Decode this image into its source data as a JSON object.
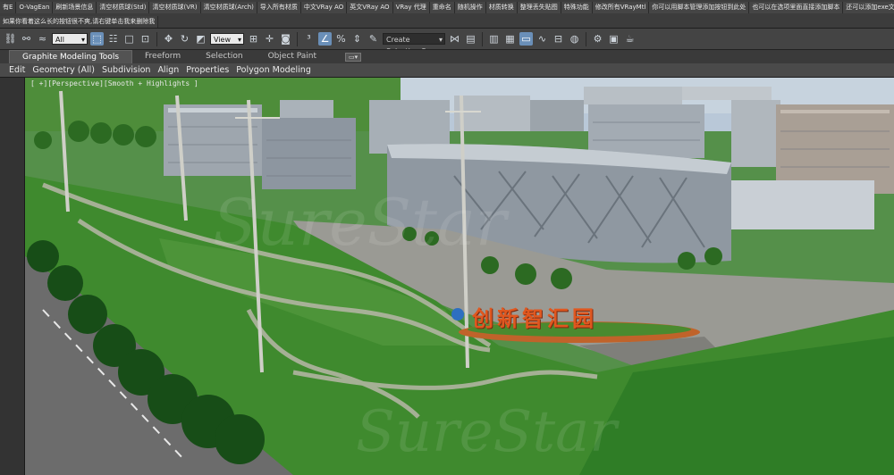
{
  "script_toolbar": {
    "row1": [
      "有E",
      "O-VagEan",
      "刷新场景信息",
      "清空材质球(Std)",
      "清空材质球(VR)",
      "清空材质球(Arch)",
      "导入所有材质",
      "中文VRay AO",
      "英文VRay AO",
      "VRay 代理",
      "重命名",
      "随机操作",
      "材质转换",
      "整理丢失贴图",
      "特殊功能",
      "修改所有VRayMtl",
      "你可以用脚本管理添加按钮到此处",
      "也可以在选项里面直接添加脚本",
      "还可以添加exe文"
    ],
    "row2": [
      "如果你看着这么长的按钮很不爽,请右键单击我来删除我"
    ]
  },
  "main_toolbar": {
    "filter_value": "All",
    "view_value": "View",
    "selection_set_placeholder": "Create Selection Se"
  },
  "ribbon": {
    "tabs": [
      "Graphite Modeling Tools",
      "Freeform",
      "Selection",
      "Object Paint"
    ],
    "options_icon": "▭▾",
    "panels": [
      "Edit",
      "Geometry (All)",
      "Subdivision",
      "Align",
      "Properties",
      "Polygon Modeling"
    ]
  },
  "viewport": {
    "label": "[ +][Perspective][Smooth + Highlights ]",
    "sign_text": "创新智汇园",
    "watermark": "SureStar"
  },
  "colors": {
    "grass": "#3f8a2e",
    "sign": "#e0571f",
    "active_tool": "#6a8fb8"
  },
  "icons": [
    "select-and-link-icon",
    "unlink-icon",
    "bind-space-warp-icon",
    "select-object-icon",
    "select-by-name-icon",
    "rect-selection-icon",
    "window-crossing-icon",
    "select-move-icon",
    "select-rotate-icon",
    "select-scale-icon",
    "pivot-icon",
    "snap-icon",
    "angle-snap-icon",
    "percent-snap-icon",
    "spinner-snap-icon",
    "edit-named-sets-icon",
    "mirror-icon",
    "align-icon",
    "layer-manager-icon",
    "curve-editor-icon",
    "schematic-view-icon",
    "material-editor-icon",
    "render-setup-icon",
    "render-frame-icon",
    "render-icon"
  ]
}
